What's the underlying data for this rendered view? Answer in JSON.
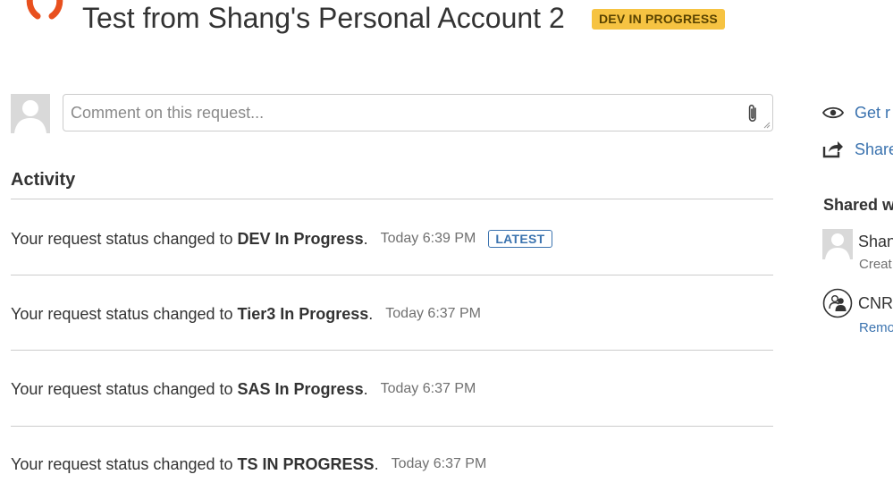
{
  "header": {
    "title": "Test from Shang's Personal Account 2",
    "status_lozenge": "DEV IN PROGRESS",
    "status_color": "#f6c342"
  },
  "comment": {
    "placeholder": "Comment on this request...",
    "value": "",
    "attach_icon": "paperclip-icon"
  },
  "activity": {
    "heading": "Activity",
    "prefix": "Your request status changed to",
    "items": [
      {
        "status": "DEV In Progress",
        "time": "Today 6:39 PM",
        "badge": "LATEST"
      },
      {
        "status": "Tier3 In Progress",
        "time": "Today 6:37 PM"
      },
      {
        "status": "SAS In Progress",
        "time": "Today 6:37 PM"
      },
      {
        "status": "TS IN PROGRESS",
        "time": "Today 6:37 PM"
      }
    ]
  },
  "sidebar": {
    "notify_label": "Get r",
    "share_label": "Share",
    "shared_heading": "Shared w",
    "participants": [
      {
        "name": "Shan",
        "sub": "Creat"
      },
      {
        "name": "CNR",
        "sub": "Remo"
      }
    ]
  },
  "colors": {
    "link": "#3b73af",
    "brand_orange": "#e8501e"
  }
}
